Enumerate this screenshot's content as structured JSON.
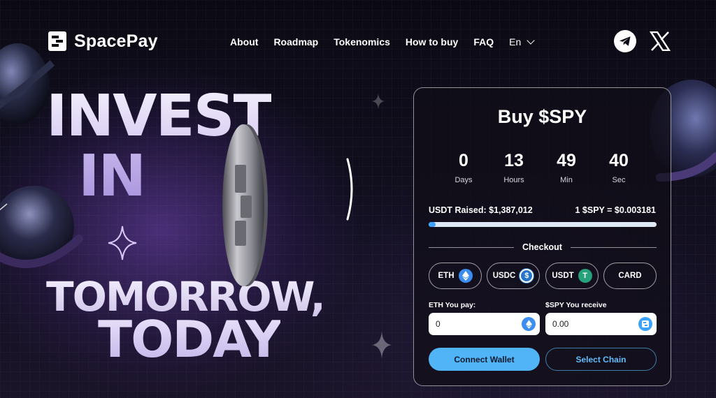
{
  "brand": {
    "name": "SpacePay"
  },
  "nav": {
    "items": [
      "About",
      "Roadmap",
      "Tokenomics",
      "How to buy",
      "FAQ"
    ],
    "language": "En"
  },
  "socials": {
    "telegram_icon": "telegram-icon",
    "x_icon": "x-icon"
  },
  "hero": {
    "line1": "INVEST",
    "line2": "IN",
    "line3": "TOMORROW,",
    "line4": "TODAY"
  },
  "buy_panel": {
    "title": "Buy $SPY",
    "countdown": [
      {
        "value": "0",
        "label": "Days"
      },
      {
        "value": "13",
        "label": "Hours"
      },
      {
        "value": "49",
        "label": "Min"
      },
      {
        "value": "40",
        "label": "Sec"
      }
    ],
    "raised": "USDT Raised: $1,387,012",
    "rate": "1 $SPY = $0.003181",
    "progress_fraction": 0.03,
    "checkout_label": "Checkout",
    "payment_options": [
      {
        "label": "ETH",
        "icon": "eth-icon",
        "color": "#3b8df0"
      },
      {
        "label": "USDC",
        "icon": "usdc-icon",
        "color": "#2775ca"
      },
      {
        "label": "USDT",
        "icon": "usdt-icon",
        "color": "#26a17b"
      },
      {
        "label": "CARD",
        "icon": "",
        "color": ""
      }
    ],
    "pay_label": "ETH You pay:",
    "pay_value": "0",
    "receive_label": "$SPY You receive",
    "receive_value": "0.00",
    "connect_button": "Connect Wallet",
    "chain_button": "Select Chain"
  },
  "colors": {
    "accent": "#51b4f6",
    "progress": "#3ba3ff",
    "background": "#0f0c1a"
  }
}
